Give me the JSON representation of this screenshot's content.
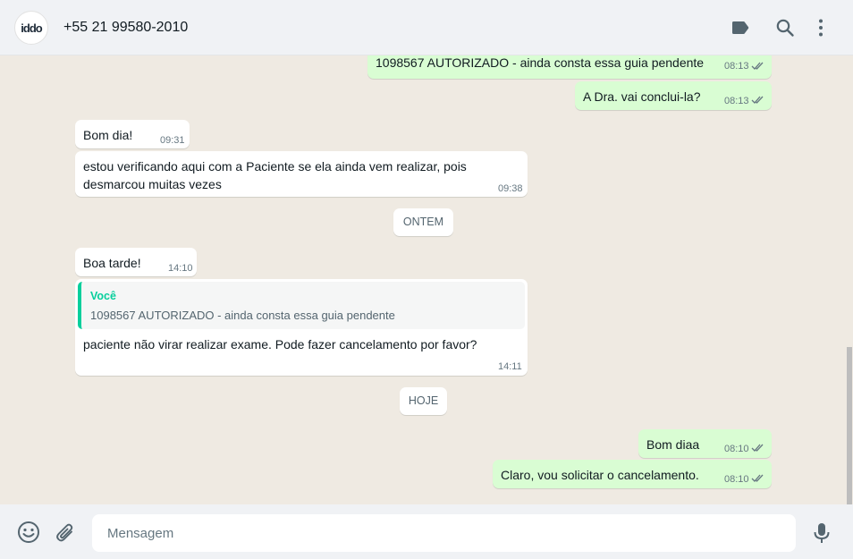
{
  "header": {
    "avatar_text": "iddo",
    "contact_name": "+55 21 99580-2010",
    "icons": [
      "label-icon",
      "search-icon",
      "menu-icon"
    ]
  },
  "messages": [
    {
      "direction": "out",
      "text": "1098567 AUTORIZADO - ainda consta essa guia pendente",
      "time": "08:13",
      "status": "read"
    },
    {
      "direction": "out",
      "text": "A Dra. vai conclui-la?",
      "time": "08:13",
      "status": "read"
    },
    {
      "direction": "in",
      "text": "Bom dia!",
      "time": "09:31"
    },
    {
      "direction": "in",
      "text": "estou verificando aqui com a Paciente se ela ainda vem realizar, pois\ndesmarcou muitas vezes",
      "time": "09:38"
    },
    {
      "type": "date",
      "text": "ONTEM"
    },
    {
      "direction": "in",
      "text": "Boa tarde!",
      "time": "14:10"
    },
    {
      "direction": "in",
      "quote": {
        "author": "Você",
        "text": "1098567 AUTORIZADO - ainda consta essa guia pendente"
      },
      "text": "paciente não virar realizar exame. Pode fazer cancelamento por favor?",
      "time": "14:11"
    },
    {
      "type": "date",
      "text": "HOJE"
    },
    {
      "direction": "out",
      "text": "Bom diaa",
      "time": "08:10",
      "status": "read"
    },
    {
      "direction": "out",
      "text": "Claro, vou solicitar o cancelamento.",
      "time": "08:10",
      "status": "read"
    }
  ],
  "composer": {
    "placeholder": "Mensagem",
    "value": "",
    "icons": [
      "emoji-icon",
      "attach-icon",
      "microphone-icon"
    ]
  },
  "colors": {
    "chat_background": "#efeae2",
    "outgoing_bubble": "#d9fdd3",
    "incoming_bubble": "#ffffff",
    "quote_accent": "#06cf9c",
    "read_ticks": "#667781"
  }
}
